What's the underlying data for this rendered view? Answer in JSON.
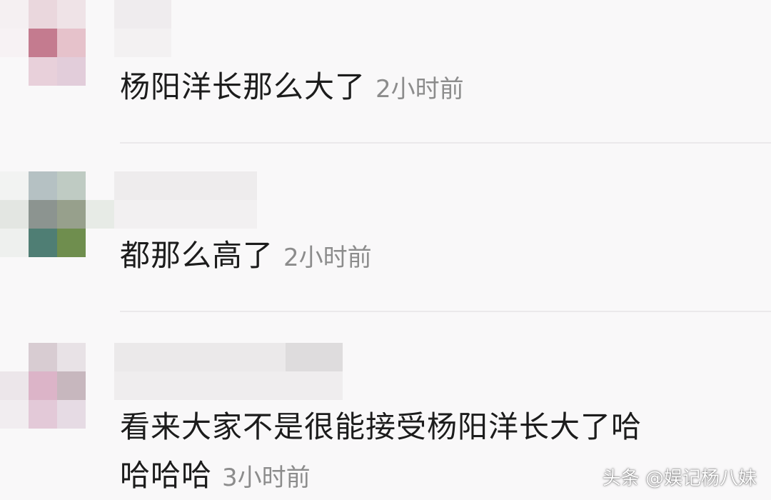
{
  "comments": [
    {
      "text": "杨阳洋长那么大了",
      "time": "2小时前"
    },
    {
      "text": "都那么高了",
      "time": "2小时前"
    },
    {
      "text_line1": "看来大家不是很能接受杨阳洋长大了哈",
      "text_line2": "哈哈哈",
      "time": "3小时前"
    }
  ],
  "watermark": "头条 @娱记杨八妹",
  "colors": {
    "background": "#f9f8f9",
    "comment_text": "#1c1c1c",
    "timestamp": "#8c8c8c",
    "divider": "#ebe9eb"
  }
}
